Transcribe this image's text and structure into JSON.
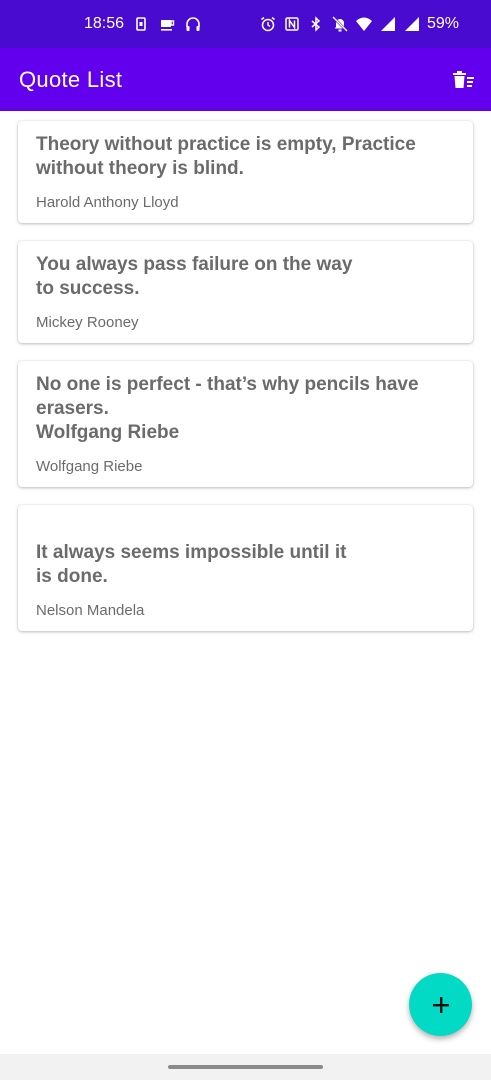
{
  "status_bar": {
    "time": "18:56",
    "battery": "59%",
    "left_icons": [
      "sim-icon",
      "cup-icon",
      "headphones-icon"
    ],
    "right_icons": [
      "alarm-icon",
      "nfc-icon",
      "bluetooth-icon",
      "mute-icon",
      "wifi-icon",
      "signal-icon",
      "signal-icon-2"
    ]
  },
  "app_bar": {
    "title": "Quote List",
    "action_icon": "delete-all-icon"
  },
  "quotes": [
    {
      "text": "Theory without practice is empty, Practice without theory is blind.",
      "author": "Harold Anthony Lloyd"
    },
    {
      "text": "You always pass failure on the way\nto success.",
      "author": "Mickey Rooney"
    },
    {
      "text": "No one is perfect - that’s why pencils have erasers.\nWolfgang Riebe",
      "author": "Wolfgang Riebe"
    },
    {
      "text": "It always seems impossible until it\nis done.",
      "author": "Nelson Mandela"
    }
  ],
  "fab": {
    "icon": "plus-icon"
  },
  "colors": {
    "status_bar": "#4a0bd0",
    "app_bar": "#6200ee",
    "fab": "#03dac5",
    "text_gray": "#6b6b6b"
  }
}
